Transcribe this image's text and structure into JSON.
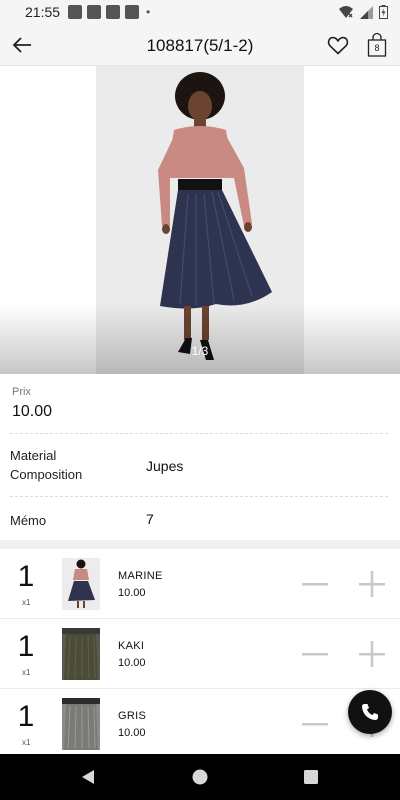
{
  "status_bar": {
    "time": "21:55",
    "dot": "•",
    "icons": [
      "notification-icon",
      "notification-icon",
      "notification-icon",
      "notification-icon",
      "wifi-icon",
      "signal-icon",
      "battery-icon"
    ]
  },
  "app_bar": {
    "title": "108817(5/1-2)",
    "cart_count": "8",
    "icons": [
      "back-arrow-icon",
      "heart-icon",
      "shopping-bag-icon"
    ]
  },
  "gallery": {
    "pager": "1/3"
  },
  "product": {
    "price_label": "Prix",
    "price_value": "10.00",
    "material_label_line1": "Material",
    "material_label_line2": "Composition",
    "material_value": "Jupes",
    "memo_label": "Mémo",
    "memo_value": "7"
  },
  "variants": [
    {
      "qty": "1",
      "unit": "x1",
      "color": "MARINE",
      "price": "10.00",
      "swatch": "#2e3350",
      "top": "#c98a84"
    },
    {
      "qty": "1",
      "unit": "x1",
      "color": "KAKI",
      "price": "10.00",
      "swatch": "#4b4c38",
      "top": "#3a3a34"
    },
    {
      "qty": "1",
      "unit": "x1",
      "color": "GRIS",
      "price": "10.00",
      "swatch": "#7a7a78",
      "top": "#2c2c2c"
    }
  ],
  "fab": {
    "icon": "phone-icon"
  },
  "colors": {
    "app_bar_bg": "#f5f5f5",
    "accent_dark": "#111111",
    "stepper": "#c8c8c8"
  }
}
